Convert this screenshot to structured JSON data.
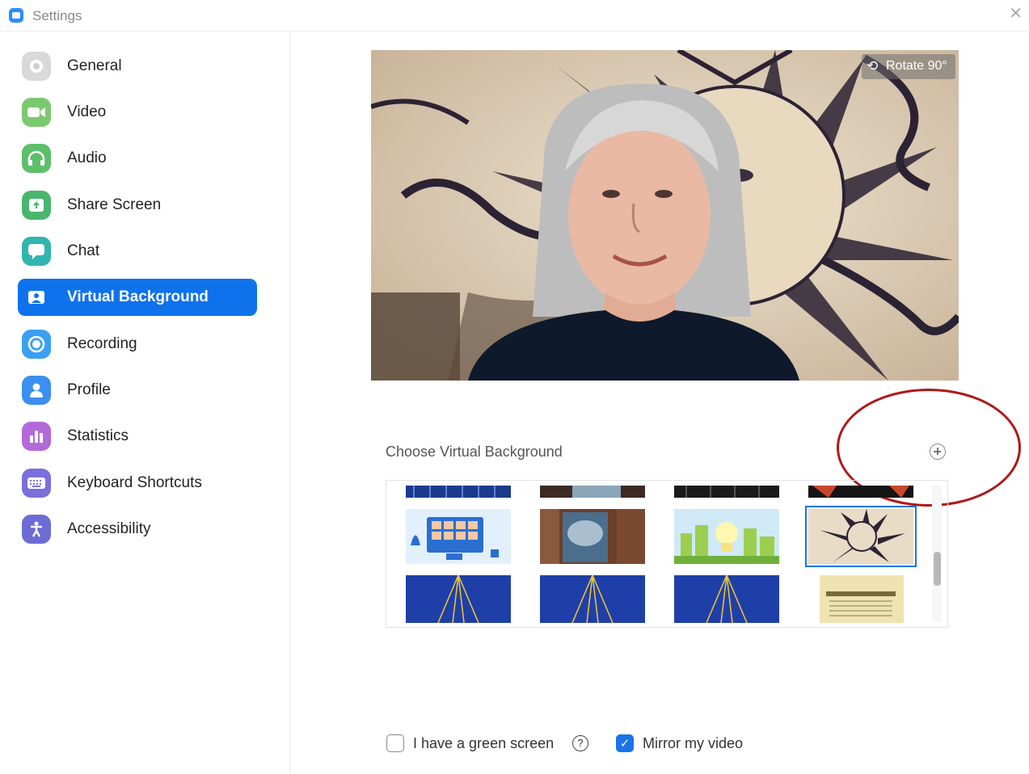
{
  "window": {
    "title": "Settings",
    "close_glyph": "✕"
  },
  "sidebar": {
    "items": [
      {
        "label": "General",
        "icon": "gear-icon",
        "color": "#d8d8d8"
      },
      {
        "label": "Video",
        "icon": "video-camera-icon",
        "color": "#7bc96f"
      },
      {
        "label": "Audio",
        "icon": "headphones-icon",
        "color": "#5cbf6a"
      },
      {
        "label": "Share Screen",
        "icon": "share-screen-icon",
        "color": "#48b66d"
      },
      {
        "label": "Chat",
        "icon": "chat-bubble-icon",
        "color": "#2fb6b0"
      },
      {
        "label": "Virtual Background",
        "icon": "virtual-background-icon",
        "color": "#0e72ed",
        "active": true
      },
      {
        "label": "Recording",
        "icon": "record-icon",
        "color": "#3ba0f2"
      },
      {
        "label": "Profile",
        "icon": "person-icon",
        "color": "#3a8ff0"
      },
      {
        "label": "Statistics",
        "icon": "bar-chart-icon",
        "color": "#b36ad8"
      },
      {
        "label": "Keyboard Shortcuts",
        "icon": "keyboard-icon",
        "color": "#7b6fdc"
      },
      {
        "label": "Accessibility",
        "icon": "accessibility-icon",
        "color": "#6c6cd6"
      }
    ]
  },
  "preview": {
    "rotate_label": "Rotate 90°"
  },
  "choose": {
    "label": "Choose Virtual Background",
    "thumbnails": [
      {
        "name": "blue-curtain-partial",
        "selected": false
      },
      {
        "name": "ocean-window-partial",
        "selected": false
      },
      {
        "name": "dark-stage-partial",
        "selected": false
      },
      {
        "name": "sun-drawing-partial",
        "selected": false
      },
      {
        "name": "video-call-illustration",
        "selected": false
      },
      {
        "name": "curtain-window-room",
        "selected": false
      },
      {
        "name": "green-city-skyline",
        "selected": false
      },
      {
        "name": "sun-drawing",
        "selected": true
      },
      {
        "name": "blue-sunrays-1",
        "selected": false
      },
      {
        "name": "blue-sunrays-2",
        "selected": false
      },
      {
        "name": "blue-sunrays-3",
        "selected": false
      },
      {
        "name": "vintage-poster",
        "selected": false
      }
    ]
  },
  "options": {
    "green_screen_label": "I have a green screen",
    "green_screen_checked": false,
    "help_glyph": "?",
    "mirror_label": "Mirror my video",
    "mirror_checked": true
  }
}
